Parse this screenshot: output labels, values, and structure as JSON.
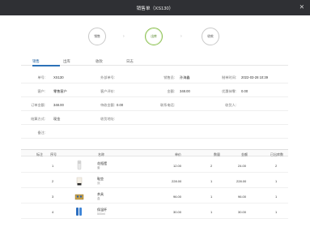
{
  "window": {
    "title": "销售单（XS130）",
    "close_icon": "close-icon"
  },
  "steps": [
    {
      "label": "销售",
      "active": false
    },
    {
      "label": "出库",
      "active": true
    },
    {
      "label": "收款",
      "active": false
    }
  ],
  "tabs": [
    {
      "label": "销售",
      "active": true
    },
    {
      "label": "出库",
      "active": false
    },
    {
      "label": "收款",
      "active": false
    },
    {
      "label": "日志",
      "active": false
    }
  ],
  "form": {
    "row1": {
      "label1": "单号:",
      "value1": "XS130",
      "label2": "外部单号:",
      "value2": "",
      "label3": "销售员:",
      "value3": "孙海鑫",
      "label4": "制单时间:",
      "value4": "2022-03-28 10:39"
    },
    "row2": {
      "label1": "客户:",
      "value1": "零售客户",
      "label2": "客户评价:",
      "value2": "",
      "label3": "金额:",
      "value3": "348.00",
      "label4": "优惠抹零:",
      "value4": "0.00"
    },
    "row3": {
      "label1": "订单金额:",
      "value1": "348.00",
      "label2": "待收金额:",
      "value2": "0.00",
      "label3": "联系电话:",
      "value3": "",
      "label4": "收货人:",
      "value4": ""
    },
    "row4": {
      "label1": "结算方式:",
      "value1": "现金",
      "label2": "收货地址:",
      "value2": ""
    },
    "row5": {
      "label1": "备注:",
      "value1": ""
    }
  },
  "grid": {
    "headers": [
      "标注",
      "序号",
      "名称",
      "单价",
      "数量",
      "金额",
      "已出库数"
    ],
    "rows": [
      {
        "index": "1",
        "name": "花瓶摆",
        "spec": "套",
        "price": "12.00",
        "qty": "2",
        "amount": "24.00",
        "out": "2"
      },
      {
        "index": "2",
        "name": "鞋垫",
        "spec": "双",
        "price": "228.00",
        "qty": "1",
        "amount": "228.00",
        "out": "1"
      },
      {
        "index": "3",
        "name": "茶具",
        "spec": "盒",
        "price": "96.00",
        "qty": "1",
        "amount": "96.00",
        "out": "1"
      },
      {
        "index": "4",
        "name": "保温杯",
        "spec": "500ml",
        "price": "30.00",
        "qty": "1",
        "amount": "30.00",
        "out": "1"
      }
    ]
  }
}
